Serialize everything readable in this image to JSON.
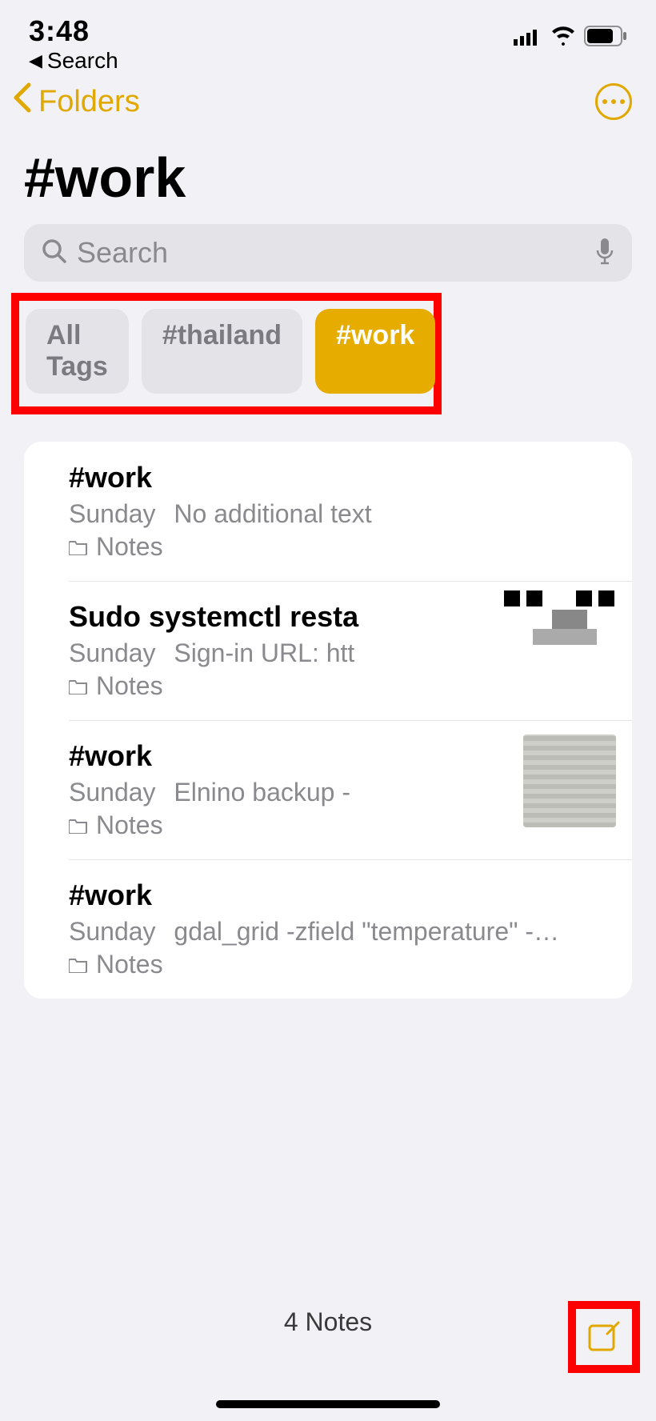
{
  "status": {
    "time": "3:48",
    "back_label": "Search"
  },
  "nav": {
    "folders_label": "Folders"
  },
  "title": "#work",
  "search": {
    "placeholder": "Search"
  },
  "tags": [
    {
      "label": "All Tags",
      "active": false
    },
    {
      "label": "#thailand",
      "active": false
    },
    {
      "label": "#work",
      "active": true
    }
  ],
  "notes": [
    {
      "title": "#work",
      "date": "Sunday",
      "preview": "No additional text",
      "folder": "Notes",
      "thumb": "none"
    },
    {
      "title": "Sudo systemctl resta",
      "date": "Sunday",
      "preview": "Sign-in URL: htt",
      "folder": "Notes",
      "thumb": "pixels"
    },
    {
      "title": "#work",
      "date": "Sunday",
      "preview": "Elnino backup -",
      "folder": "Notes",
      "thumb": "image"
    },
    {
      "title": "#work",
      "date": "Sunday",
      "preview": "gdal_grid -zfield \"temperature\" -…",
      "folder": "Notes",
      "thumb": "none"
    }
  ],
  "footer": {
    "count_label": "4 Notes"
  }
}
